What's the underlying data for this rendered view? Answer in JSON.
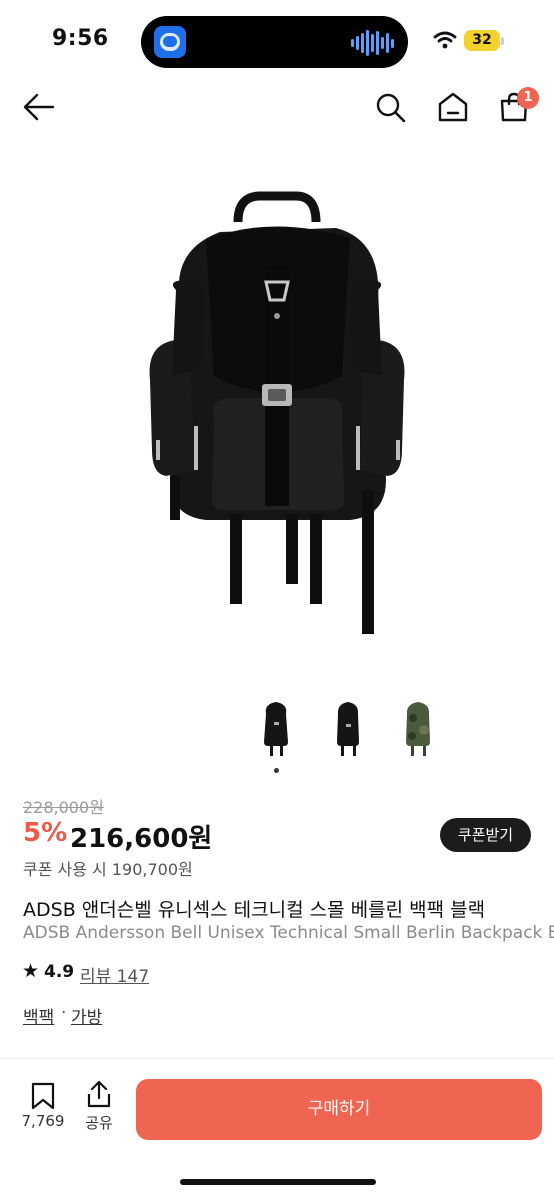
{
  "status_bar": {
    "time": "9:56",
    "battery": "32"
  },
  "header": {
    "cart_count": "1"
  },
  "thumbnails": {
    "count": 3,
    "active_index": 0
  },
  "price": {
    "original": "228,000원",
    "discount": "5%",
    "current": "216,600원",
    "coupon_button": "쿠폰받기",
    "coupon_price": "쿠폰 사용 시 190,700원"
  },
  "product": {
    "title_ko": "ADSB 앤더슨벨 유니섹스 테크니컬 스몰 베를린 백팩 블랙",
    "title_en": "ADSB Andersson Bell Unisex Technical Small Berlin Backpack Black"
  },
  "rating": {
    "star": "★",
    "score": "4.9",
    "review_text": "리뷰 147"
  },
  "categories": {
    "first": "백팩",
    "separator": "·",
    "second": "가방"
  },
  "bottom_bar": {
    "bookmark_count": "7,769",
    "share_label": "공유",
    "buy_label": "구매하기"
  },
  "colors": {
    "accent": "#f06452",
    "discount": "#ee5a4a",
    "dark_button": "#1c1c1c"
  },
  "icons": [
    "back-arrow-icon",
    "search-icon",
    "home-icon",
    "shopping-bag-icon",
    "bookmark-icon",
    "share-icon",
    "star-icon",
    "wifi-icon"
  ]
}
